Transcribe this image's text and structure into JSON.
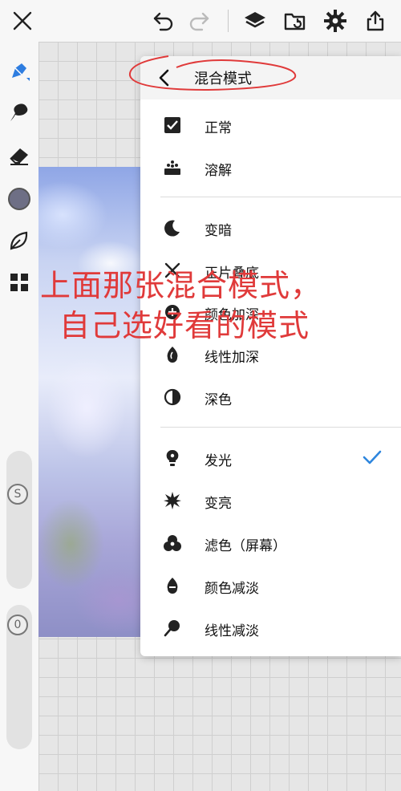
{
  "toolbar": {
    "icons": [
      "close-icon",
      "undo-icon",
      "redo-icon",
      "layers-icon",
      "file-import-icon",
      "settings-icon",
      "share-icon"
    ]
  },
  "sidebar": {
    "tools": [
      "pen-icon",
      "smudge-icon",
      "eraser-icon",
      "color-swatch",
      "leaf-icon",
      "grid-icon"
    ],
    "swatch_color": "#6e6f85",
    "size_label": "S",
    "opacity_label": "0"
  },
  "menu": {
    "title": "混合模式",
    "groups": [
      [
        {
          "label": "正常",
          "icon": "checkbox-icon"
        },
        {
          "label": "溶解",
          "icon": "dissolve-icon"
        }
      ],
      [
        {
          "label": "变暗",
          "icon": "moon-icon"
        },
        {
          "label": "正片叠底",
          "icon": "multiply-icon"
        },
        {
          "label": "颜色加深",
          "icon": "color-burn-icon"
        },
        {
          "label": "线性加深",
          "icon": "linear-burn-icon"
        },
        {
          "label": "深色",
          "icon": "half-circle-icon"
        }
      ],
      [
        {
          "label": "发光",
          "icon": "bulb-icon",
          "selected": true
        },
        {
          "label": "变亮",
          "icon": "sparkle-icon"
        },
        {
          "label": "滤色（屏幕）",
          "icon": "screen-icon"
        },
        {
          "label": "颜色减淡",
          "icon": "drop-icon"
        },
        {
          "label": "线性减淡",
          "icon": "pin-icon"
        }
      ]
    ]
  },
  "annotation": {
    "line1": "上面那张混合模式，",
    "line2": "自己选好看的模式",
    "color": "#e03a3a"
  },
  "colors": {
    "accent": "#2e86de",
    "annotation": "#e03a3a"
  }
}
